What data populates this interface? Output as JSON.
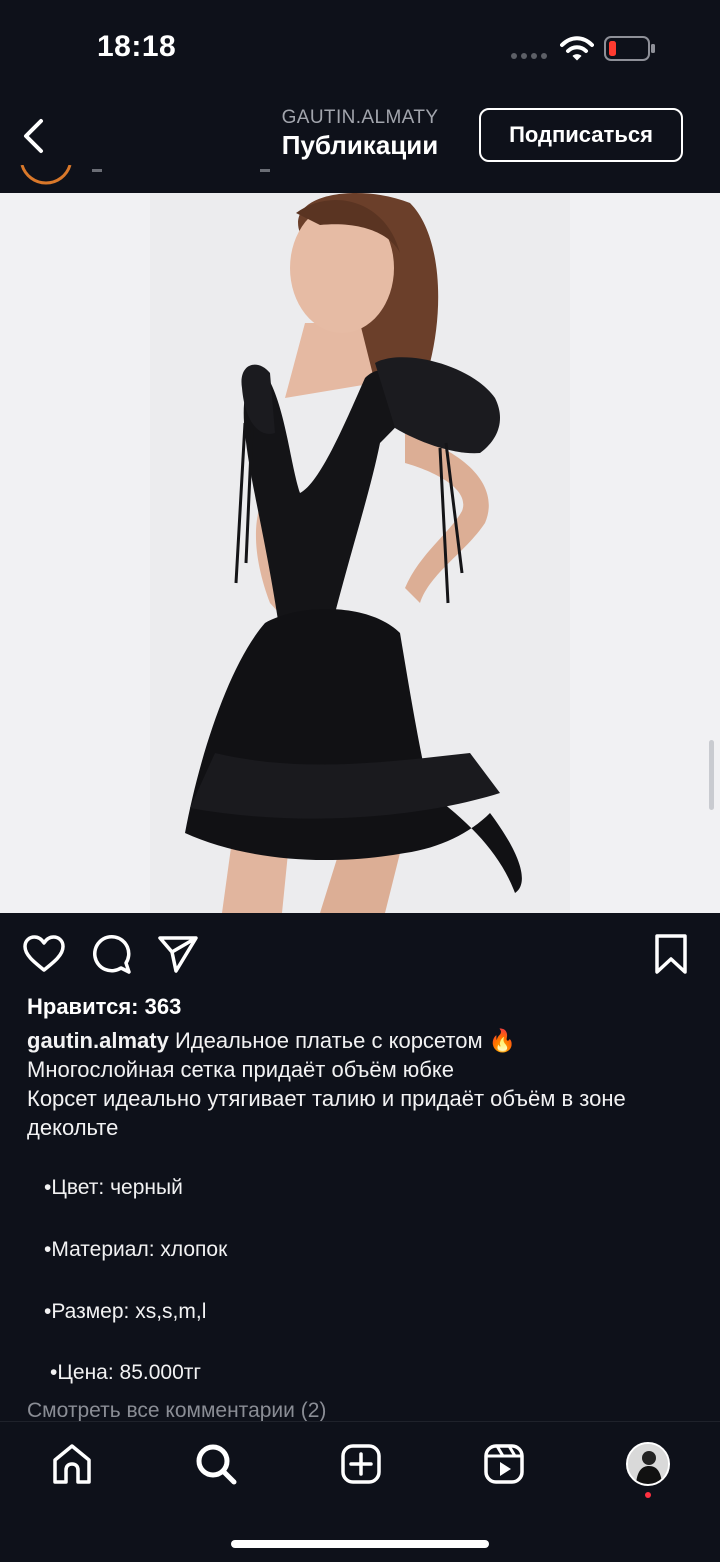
{
  "status_bar": {
    "time": "18:18",
    "battery_color": "#ff3b30"
  },
  "header": {
    "account": "GAUTIN.ALMATY",
    "title": "Публикации",
    "follow_label": "Подписаться"
  },
  "post": {
    "likes": "Нравится: 363",
    "username": "gautin.almaty",
    "caption_first_line": "Идеальное платье с корсетом",
    "emoji": "🔥",
    "caption_lines": [
      "Многослойная сетка придаёт объём юбке",
      "Корсет идеально утягивает талию и придаёт объём в зоне декольте"
    ],
    "details": {
      "color": "•Цвет: черный",
      "material": "•Материал: хлопок",
      "size": "•Размер: xs,s,m,l",
      "price": "•Цена: 85.000тг"
    },
    "view_comments": "Смотреть все комментарии (2)"
  },
  "icons": {
    "back": "chevron-left-icon",
    "like": "heart-icon",
    "comment": "comment-bubble-icon",
    "share": "paper-plane-icon",
    "save": "bookmark-icon",
    "home": "home-icon",
    "search": "search-icon",
    "create": "plus-square-icon",
    "reels": "reels-icon",
    "profile": "avatar"
  },
  "colors": {
    "background": "#0e111a",
    "text": "#ffffff",
    "muted": "#8a8d95",
    "notification": "#ff3040"
  }
}
